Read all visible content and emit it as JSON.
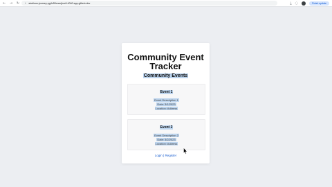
{
  "browser": {
    "url": "studious-journey-pg4x55rvwxjhvx9-4040.app.github.dev",
    "update_label": "Finish update"
  },
  "page": {
    "title_line1": "Community Event",
    "title_line2": "Tracker",
    "section_title": "Community Events"
  },
  "events": [
    {
      "name": "Event 1",
      "description": "Event Description 1",
      "date": "Date: 3/1/2023",
      "location": "Location: Address"
    },
    {
      "name": "Event 2",
      "description": "Event Description 2",
      "date": "Date: 3/2/2023",
      "location": "Location: Address"
    }
  ],
  "footer": {
    "login": "Login",
    "separator": "|",
    "register": "Register"
  },
  "icons": [
    "back-icon",
    "forward-icon",
    "reload-icon",
    "site-info-icon",
    "download-icon",
    "extensions-icon",
    "profile-avatar",
    "cursor-icon"
  ],
  "colors": {
    "background": "#eceef2",
    "highlight": "#bcd4ee",
    "link": "#1a5fd0"
  }
}
